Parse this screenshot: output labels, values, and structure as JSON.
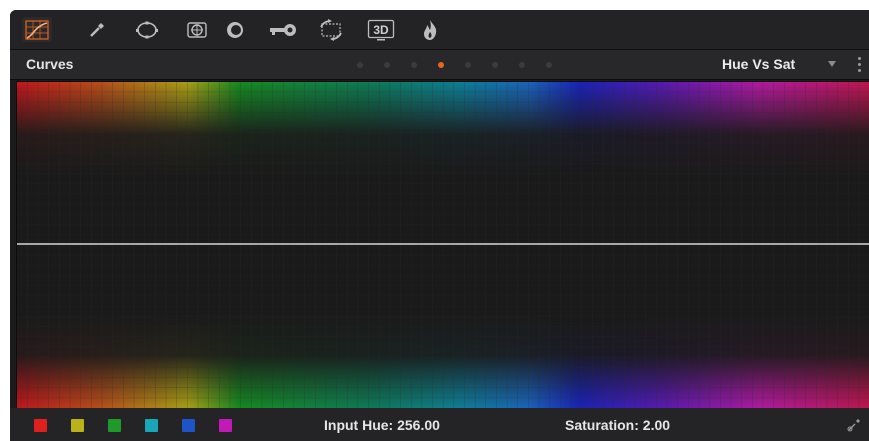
{
  "toolbar": {
    "tools": [
      {
        "name": "curves-icon",
        "active": true
      },
      {
        "name": "qualifier-eyedropper-icon",
        "active": false
      },
      {
        "name": "power-window-icon",
        "active": false
      },
      {
        "name": "tracker-icon",
        "active": false
      },
      {
        "name": "blur-icon",
        "active": false
      },
      {
        "name": "key-icon",
        "active": false
      },
      {
        "name": "sizing-icon",
        "active": false
      },
      {
        "name": "3d-icon",
        "active": false,
        "label": "3D"
      },
      {
        "name": "fx-flame-icon",
        "active": false
      }
    ],
    "accent_color": "#e8661c"
  },
  "header": {
    "title": "Curves",
    "page_dots_count": 8,
    "active_dot_index": 3,
    "mode_label": "Hue Vs Sat"
  },
  "graph": {
    "curve": "flat",
    "curve_color": "#d8d8d8"
  },
  "footer": {
    "swatches": [
      {
        "name": "red",
        "color": "#e0201c"
      },
      {
        "name": "yellow",
        "color": "#b9b21a"
      },
      {
        "name": "green",
        "color": "#1e9a2a"
      },
      {
        "name": "cyan",
        "color": "#18a6b8"
      },
      {
        "name": "blue",
        "color": "#1d55c8"
      },
      {
        "name": "magenta",
        "color": "#c21ab8"
      }
    ],
    "input_hue_label": "Input Hue: 256.00",
    "saturation_label": "Saturation: 2.00"
  }
}
